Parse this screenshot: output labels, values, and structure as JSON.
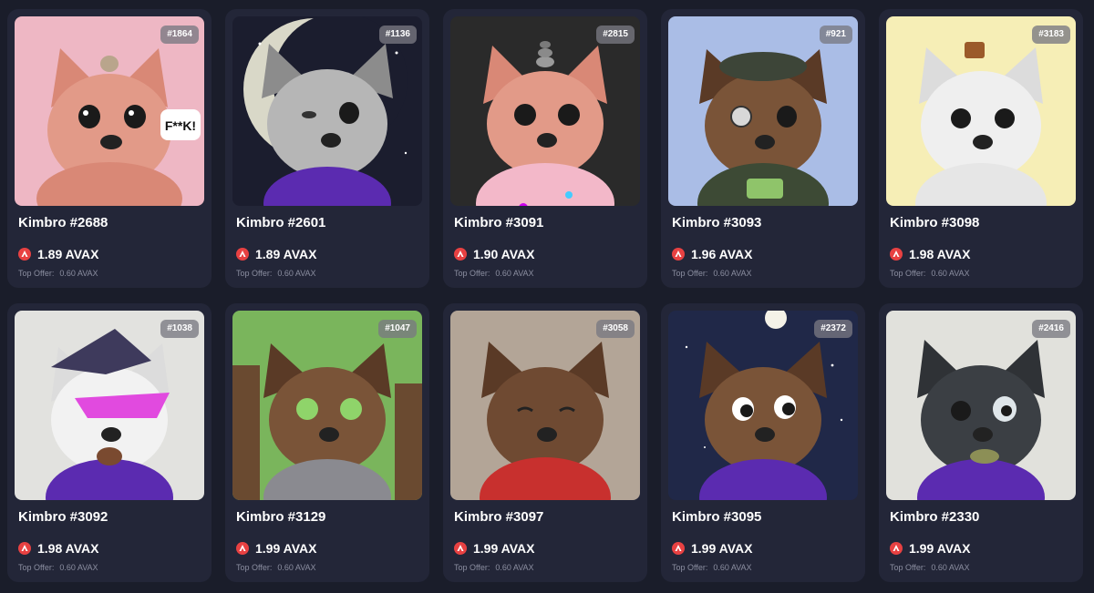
{
  "accent": "#e84142",
  "currency_icon": "avax-icon",
  "cards": [
    {
      "rank": "#1864",
      "name": "Kimbro #2688",
      "price": "1.89 AVAX",
      "offer_label": "Top Offer:",
      "offer_value": "0.60 AVAX",
      "speech_text": "F**K!"
    },
    {
      "rank": "#1136",
      "name": "Kimbro #2601",
      "price": "1.89 AVAX",
      "offer_label": "Top Offer:",
      "offer_value": "0.60 AVAX"
    },
    {
      "rank": "#2815",
      "name": "Kimbro #3091",
      "price": "1.90 AVAX",
      "offer_label": "Top Offer:",
      "offer_value": "0.60 AVAX"
    },
    {
      "rank": "#921",
      "name": "Kimbro #3093",
      "price": "1.96 AVAX",
      "offer_label": "Top Offer:",
      "offer_value": "0.60 AVAX"
    },
    {
      "rank": "#3183",
      "name": "Kimbro #3098",
      "price": "1.98 AVAX",
      "offer_label": "Top Offer:",
      "offer_value": "0.60 AVAX"
    },
    {
      "rank": "#1038",
      "name": "Kimbro #3092",
      "price": "1.98 AVAX",
      "offer_label": "Top Offer:",
      "offer_value": "0.60 AVAX"
    },
    {
      "rank": "#1047",
      "name": "Kimbro #3129",
      "price": "1.99 AVAX",
      "offer_label": "Top Offer:",
      "offer_value": "0.60 AVAX"
    },
    {
      "rank": "#3058",
      "name": "Kimbro #3097",
      "price": "1.99 AVAX",
      "offer_label": "Top Offer:",
      "offer_value": "0.60 AVAX"
    },
    {
      "rank": "#2372",
      "name": "Kimbro #3095",
      "price": "1.99 AVAX",
      "offer_label": "Top Offer:",
      "offer_value": "0.60 AVAX"
    },
    {
      "rank": "#2416",
      "name": "Kimbro #2330",
      "price": "1.99 AVAX",
      "offer_label": "Top Offer:",
      "offer_value": "0.60 AVAX"
    }
  ]
}
